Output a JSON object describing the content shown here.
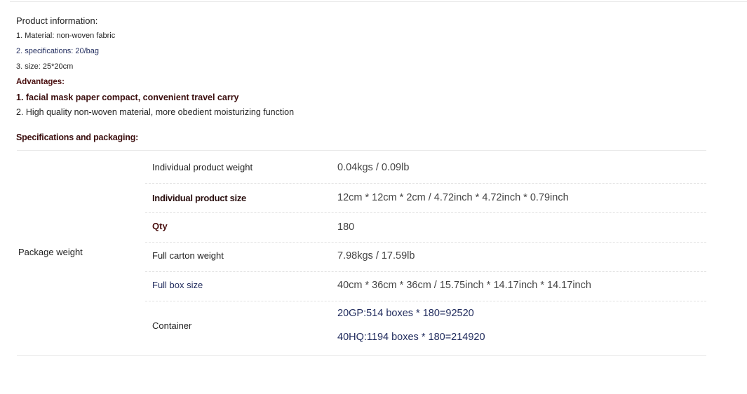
{
  "product_info": {
    "heading": "Product information:",
    "items": [
      "1. Material: non-woven fabric",
      "2. specifications: 20/bag",
      "3. size: 25*20cm"
    ]
  },
  "advantages": {
    "heading": "Advantages:",
    "items": [
      "1. facial mask paper compact, convenient travel carry",
      "2. High quality non-woven material, more obedient moisturizing function"
    ]
  },
  "specifications": {
    "heading": "Specifications and packaging:",
    "group_label": "Package weight",
    "rows": [
      {
        "label": "Individual product weight",
        "value": "0.04kgs / 0.09lb"
      },
      {
        "label": "Individual product size",
        "value": "12cm * 12cm * 2cm / 4.72inch * 4.72inch * 0.79inch"
      },
      {
        "label": "Qty",
        "value": "180"
      },
      {
        "label": "Full carton weight",
        "value": "7.98kgs / 17.59lb"
      },
      {
        "label": "Full box size",
        "value": "40cm * 36cm * 36cm / 15.75inch * 14.17inch * 14.17inch"
      },
      {
        "label": "Container",
        "values": [
          "20GP:514 boxes * 180=92520",
          "40HQ:1194 boxes * 180=214920"
        ]
      }
    ]
  },
  "colors": {
    "navy_text": "#1f2a5c",
    "maroon_text": "#3a0d0d",
    "divider": "#e2e2e2"
  }
}
